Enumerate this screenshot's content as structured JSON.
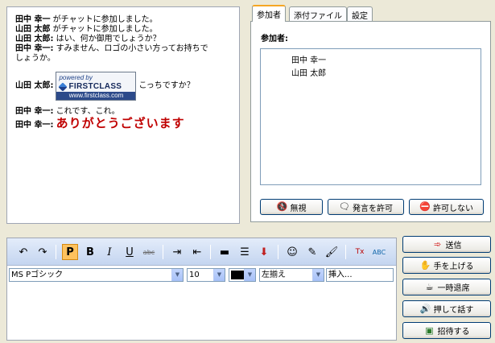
{
  "chat": {
    "messages": [
      {
        "who": "田中 幸一",
        "text": " がチャットに参加しました。"
      },
      {
        "who": "山田 太郎",
        "text": " がチャットに参加しました。"
      },
      {
        "who": "山田 太郎:",
        "text": " はい、何か御用でしょうか？"
      },
      {
        "who": "田中 幸一:",
        "text": " すみません、ロゴの小さい方ってお持ちで"
      },
      {
        "who": "",
        "text": "しょうか。"
      }
    ],
    "ad_message": {
      "who": "山田 太郎:",
      "text": "こっちですか？"
    },
    "logo": {
      "powered_by": "powered by",
      "brand": "FIRSTCLASS",
      "url": "www.firstclass.com"
    },
    "reply1": {
      "who": "田中 幸一:",
      "text": " これです、これ。"
    },
    "reply2": {
      "who": "田中 幸一:",
      "text": "ありがとうございます"
    }
  },
  "tabs": [
    "参加者",
    "添付ファイル",
    "設定"
  ],
  "participants": {
    "heading": "参加者:",
    "list": [
      "田中 幸一",
      "山田 太郎"
    ],
    "buttons": {
      "ignore": "無視",
      "allow": "発言を許可",
      "deny": "許可しない"
    }
  },
  "toolbar": {
    "plain": "P",
    "bold": "B",
    "italic": "I",
    "underline": "U",
    "strike": "abc"
  },
  "format": {
    "font": "MS Pゴシック",
    "size": "10",
    "align": "左揃え",
    "insert": "挿入..."
  },
  "actions": {
    "send": "送信",
    "raise_hand": "手を上げる",
    "away": "一時退席",
    "push_to_talk": "押して話す",
    "invite": "招待する"
  },
  "colors": {
    "accent_tab": "#f5a623",
    "big_text": "#c00000"
  }
}
